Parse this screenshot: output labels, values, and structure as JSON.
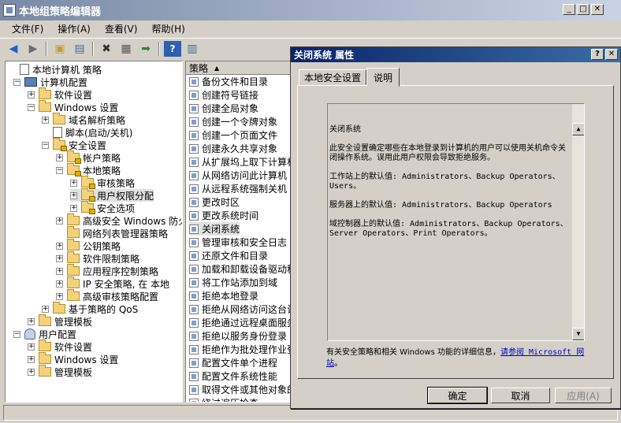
{
  "window": {
    "title": "本地组策略编辑器"
  },
  "menu": [
    "文件(F)",
    "操作(A)",
    "查看(V)",
    "帮助(H)"
  ],
  "toolbar": {
    "icons": [
      "back-arrow-icon",
      "forward-arrow-icon",
      "up-folder-icon",
      "show-hide-tree-icon",
      "delete-icon",
      "properties-icon",
      "export-icon",
      "help-icon",
      "view-icon"
    ]
  },
  "tree": [
    {
      "label": "本地计算机 策略",
      "icon": "doc",
      "exp": ""
    },
    {
      "label": "计算机配置",
      "icon": "pc",
      "exp": "−"
    },
    {
      "label": "软件设置",
      "icon": "folder",
      "exp": "+"
    },
    {
      "label": "Windows 设置",
      "icon": "folder",
      "exp": "−"
    },
    {
      "label": "域名解析策略",
      "icon": "folder",
      "exp": "+"
    },
    {
      "label": "脚本(启动/关机)",
      "icon": "doc",
      "exp": ""
    },
    {
      "label": "安全设置",
      "icon": "folder-lock",
      "exp": "−"
    },
    {
      "label": "帐户策略",
      "icon": "folder-lock",
      "exp": "+"
    },
    {
      "label": "本地策略",
      "icon": "folder-lock",
      "exp": "−"
    },
    {
      "label": "审核策略",
      "icon": "folder-lock",
      "exp": "+"
    },
    {
      "label": "用户权限分配",
      "icon": "folder-lock",
      "exp": "+",
      "selected": true
    },
    {
      "label": "安全选项",
      "icon": "folder-lock",
      "exp": "+"
    },
    {
      "label": "高级安全 Windows 防火",
      "icon": "folder",
      "exp": "+"
    },
    {
      "label": "网络列表管理器策略",
      "icon": "folder",
      "exp": ""
    },
    {
      "label": "公钥策略",
      "icon": "folder",
      "exp": "+"
    },
    {
      "label": "软件限制策略",
      "icon": "folder",
      "exp": "+"
    },
    {
      "label": "应用程序控制策略",
      "icon": "folder",
      "exp": "+"
    },
    {
      "label": "IP 安全策略, 在 本地",
      "icon": "folder",
      "exp": "+"
    },
    {
      "label": "高级审核策略配置",
      "icon": "folder",
      "exp": "+"
    },
    {
      "label": "基于策略的 QoS",
      "icon": "folder",
      "exp": "+"
    },
    {
      "label": "管理模板",
      "icon": "folder",
      "exp": "+"
    },
    {
      "label": "用户配置",
      "icon": "user",
      "exp": "−"
    },
    {
      "label": "软件设置",
      "icon": "folder",
      "exp": "+"
    },
    {
      "label": "Windows 设置",
      "icon": "folder",
      "exp": "+"
    },
    {
      "label": "管理模板",
      "icon": "folder",
      "exp": "+"
    }
  ],
  "list": {
    "header": "策略",
    "items": [
      "备份文件和目录",
      "创建符号链接",
      "创建全局对象",
      "创建一个令牌对象",
      "创建一个页面文件",
      "创建永久共享对象",
      "从扩展坞上取下计算机",
      "从网络访问此计算机",
      "从远程系统强制关机",
      "更改时区",
      "更改系统时间",
      "关闭系统",
      "管理审核和安全日志",
      "还原文件和目录",
      "加载和卸载设备驱动程",
      "将工作站添加到域",
      "拒绝本地登录",
      "拒绝从网络访问这台计",
      "拒绝通过远程桌面服务",
      "拒绝以服务身份登录",
      "拒绝作为批处理作业登",
      "配置文件单个进程",
      "配置文件系统性能",
      "取得文件或其他对象的",
      "绕过遍历检查"
    ],
    "selected_index": 11
  },
  "dialog": {
    "title": "关闭系统 属性",
    "tabs": [
      "本地安全设置",
      "说明"
    ],
    "active_tab": 1,
    "explain": [
      "关闭系统",
      "",
      "此安全设置确定哪些在本地登录到计算机的用户可以使用关机命令关闭操作系统。误用此用户权限会导致拒绝服务。",
      "",
      "工作站上的默认值: Administrators、Backup Operators、Users。",
      "",
      "服务器上的默认值: Administrators、Backup Operators",
      "",
      "域控制器上的默认值: Administrators、Backup Operators、Server Operators、Print Operators。"
    ],
    "link_prefix": "有关安全策略和相关 Windows 功能的详细信息，",
    "link_text": "请参阅 Microsoft 网站",
    "link_suffix": "。",
    "buttons": {
      "ok": "确定",
      "cancel": "取消",
      "apply": "应用(A)"
    }
  }
}
